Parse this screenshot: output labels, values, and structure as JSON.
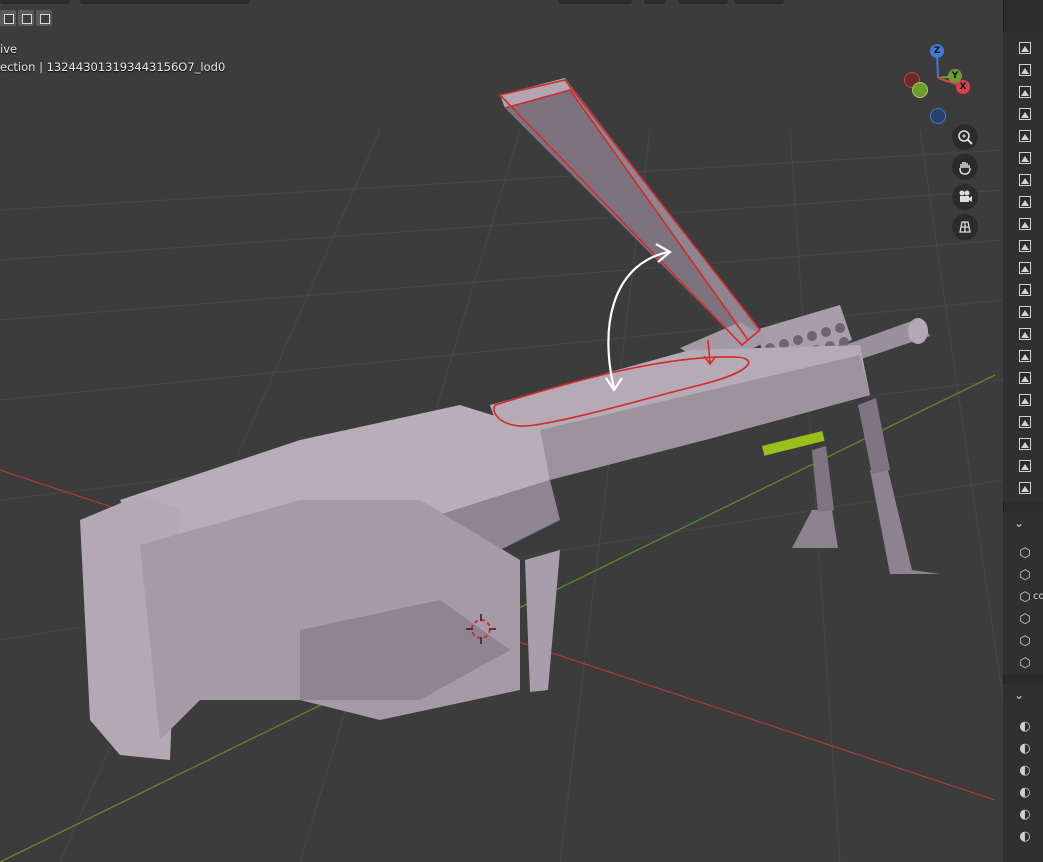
{
  "viewport": {
    "mode_label": "ive",
    "collection_label": "ection | 132443013193443156O7_lod0",
    "gizmo": {
      "z": "Z",
      "y": "Y",
      "x": "X"
    },
    "nav_buttons": [
      "zoom-icon",
      "hand-pan-icon",
      "camera-icon",
      "grid-view-icon"
    ]
  },
  "outliner": {
    "image_rows": 21,
    "collections": [
      {
        "icon": "cube-icon",
        "label": ""
      },
      {
        "icon": "cube-icon",
        "label": ""
      },
      {
        "icon": "cube-icon",
        "label": "co"
      },
      {
        "icon": "cube-icon",
        "label": ""
      },
      {
        "icon": "cube-icon",
        "label": ""
      },
      {
        "icon": "cube-icon",
        "label": ""
      }
    ],
    "materials": 6
  },
  "colors": {
    "axis_x": "#a83a3a",
    "axis_y": "#5e8a2a",
    "selection": "#d32a2a",
    "annotation": "#ffffff"
  }
}
